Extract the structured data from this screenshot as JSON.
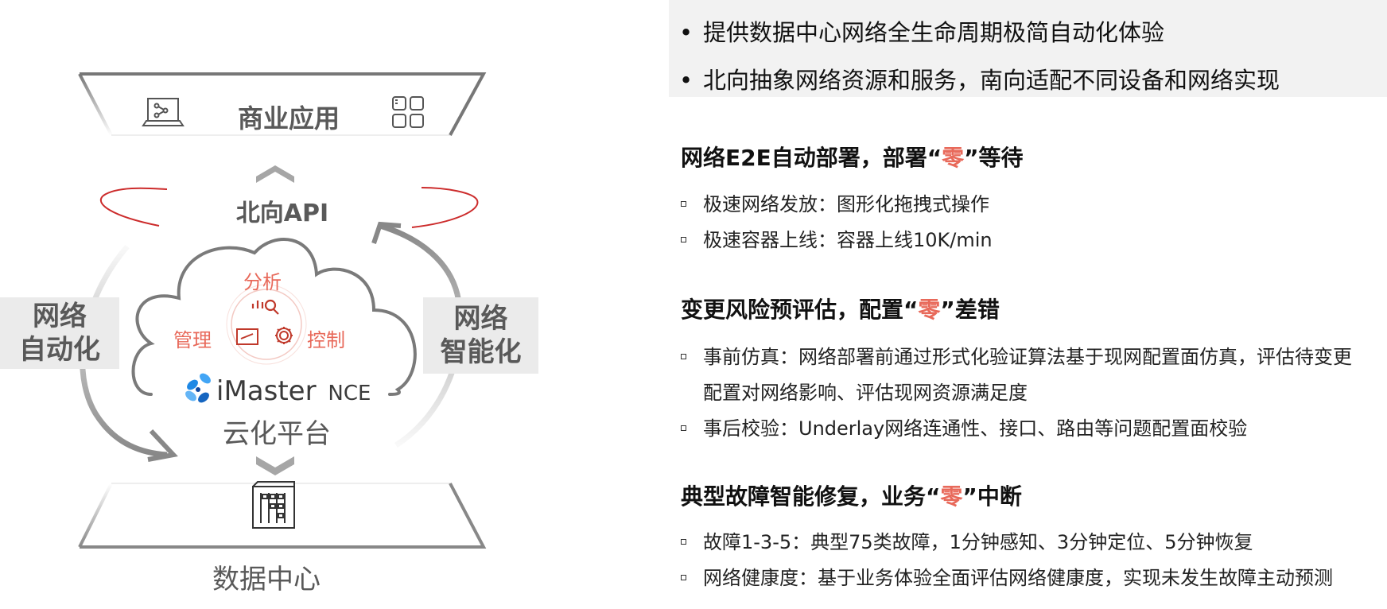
{
  "diagram": {
    "top_label": "商业应用",
    "api_label": "北向API",
    "left_label": [
      "网络",
      "自动化"
    ],
    "right_label": [
      "网络",
      "智能化"
    ],
    "cloud": {
      "analysis": "分析",
      "manage": "管理",
      "control": "控制",
      "product": "iMaster",
      "product_suffix": "NCE"
    },
    "platform_label": "云化平台",
    "bottom_label": "数据中心"
  },
  "summary": {
    "bullets": [
      "提供数据中心网络全生命周期极简自动化体验",
      "北向抽象网络资源和服务，南向适配不同设备和网络实现"
    ]
  },
  "sections": [
    {
      "title_pre": "网络E2E自动部署，部署“",
      "title_zero": "零",
      "title_post": "”等待",
      "items": [
        "极速网络发放：图形化拖拽式操作",
        "极速容器上线：容器上线10K/min"
      ]
    },
    {
      "title_pre": "变更风险预评估，配置“",
      "title_zero": "零",
      "title_post": "”差错",
      "items": [
        "事前仿真：网络部署前通过形式化验证算法基于现网配置面仿真，评估待变更配置对网络影响、评估现网资源满足度",
        "事后校验：Underlay网络连通性、接口、路由等问题配置面校验"
      ]
    },
    {
      "title_pre": "典型故障智能修复，业务“",
      "title_zero": "零",
      "title_post": "”中断",
      "items": [
        "故障1-3-5：典型75类故障，1分钟感知、3分钟定位、5分钟恢复",
        "网络健康度：基于业务体验全面评估网络健康度，实现未发生故障主动预测"
      ]
    }
  ],
  "colors": {
    "accent_red": "#e8695a",
    "diagram_gray": "#7a7a7a",
    "label_gray": "#595959",
    "panel_bg": "#f2f2f2"
  }
}
